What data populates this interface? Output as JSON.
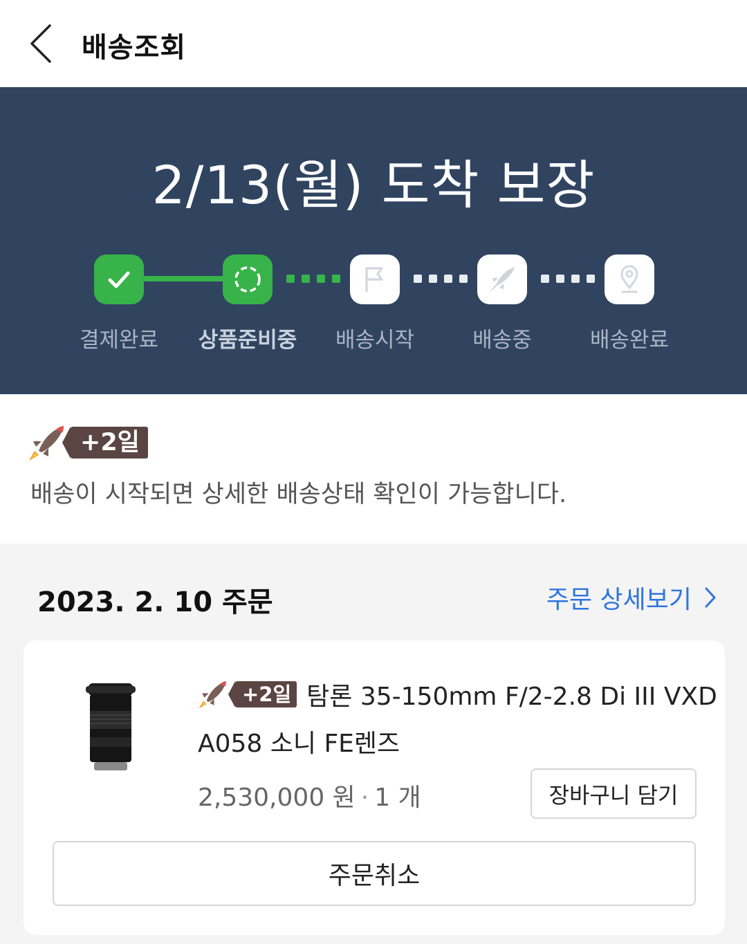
{
  "header": {
    "title": "배송조회",
    "back_icon": "chevron-left-icon"
  },
  "hero": {
    "title": "2/13(월) 도착 보장",
    "steps": [
      {
        "label": "결제완료",
        "icon": "check-icon",
        "state": "done"
      },
      {
        "label": "상품준비중",
        "icon": "progress-circle-icon",
        "state": "active"
      },
      {
        "label": "배송시작",
        "icon": "flag-icon",
        "state": "pending"
      },
      {
        "label": "배송중",
        "icon": "rocket-icon",
        "state": "pending"
      },
      {
        "label": "배송완료",
        "icon": "location-pin-icon",
        "state": "pending"
      }
    ],
    "colors": {
      "background": "#304460",
      "done": "#37b34a"
    }
  },
  "notice": {
    "badge": "+2일",
    "text": "배송이 시작되면 상세한 배송상태 확인이 가능합니다."
  },
  "order": {
    "date_label": "2023. 2. 10 주문",
    "detail_link": "주문 상세보기",
    "product": {
      "badge": "+2일",
      "name_line1": "탐론 35-150mm F/2-2.8 Di III VXD",
      "name_line2": "A058 소니 FE렌즈",
      "price": "2,530,000 원",
      "separator": "·",
      "quantity": "1 개"
    },
    "cart_button": "장바구니 담기",
    "cancel_button": "주문취소",
    "colors": {
      "link": "#2f74e0",
      "badge": "#5a4543"
    }
  }
}
